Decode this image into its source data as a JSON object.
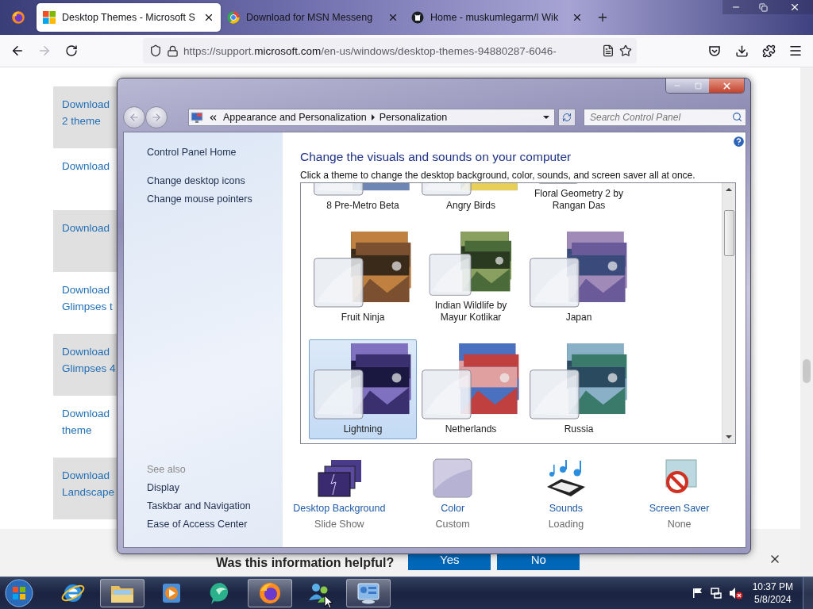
{
  "browser": {
    "tabs": [
      {
        "title": "Desktop Themes - Microsoft S",
        "selected": true,
        "kind": "squares"
      },
      {
        "title": "Download for MSN Messeng",
        "selected": false,
        "kind": "ring"
      },
      {
        "title": "Home - muskumlegarm/I Wik",
        "selected": false,
        "kind": "cat"
      }
    ],
    "url": {
      "prefix": "https://support.",
      "domain": "microsoft.com",
      "suffix": "/en-us/windows/desktop-themes-94880287-6046-"
    }
  },
  "page": {
    "cards": [
      {
        "lines": [
          "Download",
          "2 theme"
        ],
        "shaded": true
      },
      {
        "lines": [
          "Download"
        ],
        "shaded": false
      },
      {
        "lines": [
          "Download"
        ],
        "shaded": true
      },
      {
        "lines": [
          "Download",
          "Glimpses t"
        ],
        "shaded": false
      },
      {
        "lines": [
          "Download",
          "Glimpses 4"
        ],
        "shaded": true
      },
      {
        "lines": [
          "Download",
          "theme"
        ],
        "shaded": false
      },
      {
        "lines": [
          "Download",
          "Landscape"
        ],
        "shaded": true
      }
    ],
    "feedback": {
      "question": "Was this information helpful?",
      "buttons": [
        "Yes",
        "No"
      ]
    }
  },
  "window": {
    "breadcrumb": [
      "Appearance and Personalization",
      "Personalization"
    ],
    "search": {
      "placeholder": "Search Control Panel"
    },
    "sidebar": {
      "home": "Control Panel Home",
      "tasks": [
        "Change desktop icons",
        "Change mouse pointers"
      ],
      "see_also_title": "See also",
      "see_also": [
        "Display",
        "Taskbar and Navigation",
        "Ease of Access Center"
      ]
    },
    "heading": "Change the visuals and sounds on your computer",
    "intro": "Click a theme to change the desktop background, color, sounds, and screen saver all at once.",
    "themes": [
      {
        "name": "8 Pre-Metro Beta",
        "selected": false
      },
      {
        "name": "Angry Birds",
        "selected": false
      },
      {
        "name": "Floral Geometry 2 by Rangan Das",
        "selected": false
      },
      {
        "name": "Fruit Ninja",
        "selected": false
      },
      {
        "name": "Indian Wildlife by Mayur Kotlikar",
        "selected": false
      },
      {
        "name": "Japan",
        "selected": false
      },
      {
        "name": "Lightning",
        "selected": true
      },
      {
        "name": "Netherlands",
        "selected": false
      },
      {
        "name": "Russia",
        "selected": false
      }
    ],
    "settings": [
      {
        "kind": "background",
        "label": "Desktop Background",
        "value": "Slide Show"
      },
      {
        "kind": "color",
        "label": "Color",
        "value": "Custom"
      },
      {
        "kind": "sounds",
        "label": "Sounds",
        "value": "Loading"
      },
      {
        "kind": "screensaver",
        "label": "Screen Saver",
        "value": "None"
      }
    ]
  },
  "taskbar": {
    "apps": [
      {
        "kind": "ie",
        "active": false
      },
      {
        "kind": "folder",
        "active": true
      },
      {
        "kind": "media",
        "active": false
      },
      {
        "kind": "bubble",
        "active": false
      },
      {
        "kind": "browser",
        "active": true
      },
      {
        "kind": "people",
        "active": false
      },
      {
        "kind": "panel",
        "active": true
      }
    ],
    "time": "10:37 PM",
    "date": "5/8/2024"
  }
}
